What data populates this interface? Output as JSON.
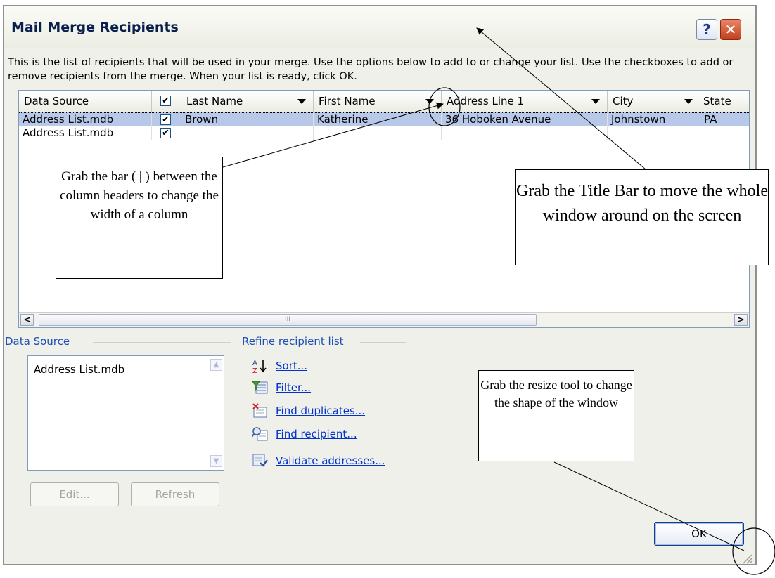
{
  "window": {
    "title": "Mail Merge Recipients",
    "help_label": "?",
    "close_label": "✕"
  },
  "description": "This is the list of recipients that will be used in your merge.  Use the options below to add to or change your list.  Use the checkboxes to add or remove recipients from the merge.  When your list is ready, click OK.",
  "table": {
    "headers": [
      "Data Source",
      "✔",
      "Last Name",
      "First Name",
      "Address Line 1",
      "City",
      "State"
    ],
    "rows": [
      {
        "source": "Address List.mdb",
        "checked": "✔",
        "last": "Brown",
        "first": "Katherine",
        "address": "36 Hoboken Avenue",
        "city": "Johnstown",
        "state": "PA",
        "selected": true
      },
      {
        "source": "Address List.mdb",
        "checked": "✔",
        "last": "",
        "first": "",
        "address": "",
        "city": "",
        "state": "",
        "selected": false
      }
    ],
    "scroll_left": "<",
    "scroll_right": ">",
    "thumb_grip": "III"
  },
  "data_source": {
    "label": "Data Source",
    "items": [
      "Address List.mdb"
    ],
    "edit_label": "Edit...",
    "refresh_label": "Refresh"
  },
  "refine": {
    "label": "Refine recipient list",
    "links": [
      {
        "label": "Sort...",
        "icon": "sort-icon"
      },
      {
        "label": "Filter...",
        "icon": "filter-icon"
      },
      {
        "label": "Find duplicates...",
        "icon": "find-duplicates-icon"
      },
      {
        "label": "Find recipient...",
        "icon": "find-recipient-icon"
      },
      {
        "label": "Validate addresses...",
        "icon": "validate-addresses-icon"
      }
    ]
  },
  "ok_label": "OK",
  "callouts": {
    "column_bar": "Grab the bar ( | ) between the column headers to change the width of a column",
    "title_bar": "Grab the Title Bar to move the whole window around on the screen",
    "resize": "Grab the resize tool to change the shape of the window"
  }
}
